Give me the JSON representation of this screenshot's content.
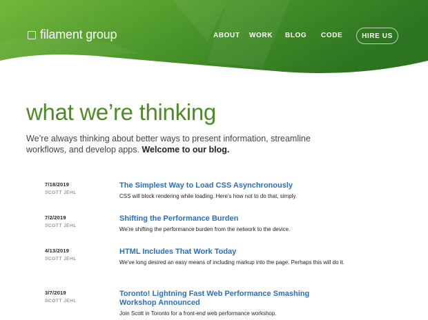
{
  "header": {
    "logo_text": "filament group",
    "nav": [
      {
        "label": "ABOUT"
      },
      {
        "label": "WORK"
      },
      {
        "label": "BLOG"
      },
      {
        "label": "CODE"
      }
    ],
    "cta_label": "HIRE US"
  },
  "main": {
    "title": "what we’re thinking",
    "intro_text": "We’re always thinking about better ways to present information, streamline workflows, and develop apps.",
    "intro_strong": "Welcome to our blog."
  },
  "posts": [
    {
      "date": "7/18/2019",
      "author": "SCOTT JEHL",
      "title": "The Simplest Way to Load CSS Asynchronously",
      "desc": "CSS will block rendering while loading. Here's how not to do that, simply."
    },
    {
      "date": "7/2/2019",
      "author": "SCOTT JEHL",
      "title": "Shifting the Performance Burden",
      "desc": "We're shifting the performance burden from the network to the device."
    },
    {
      "date": "4/13/2019",
      "author": "SCOTT JEHL",
      "title": "HTML Includes That Work Today",
      "desc": "We've long desired an easy means of including markup into the page. Perhaps this will do it."
    },
    {
      "date": "3/7/2019",
      "author": "SCOTT JEHL",
      "title": "Toronto! Lightning Fast Web Performance Smashing Workshop Announced",
      "desc": "Join Scott in Toronto for a front-end web performance workshop."
    }
  ],
  "colors": {
    "brand_green": "#4f8a26",
    "header_green_light": "#6fb83a",
    "header_green_dark": "#2f7a20",
    "link_blue": "#2a6fbd"
  }
}
